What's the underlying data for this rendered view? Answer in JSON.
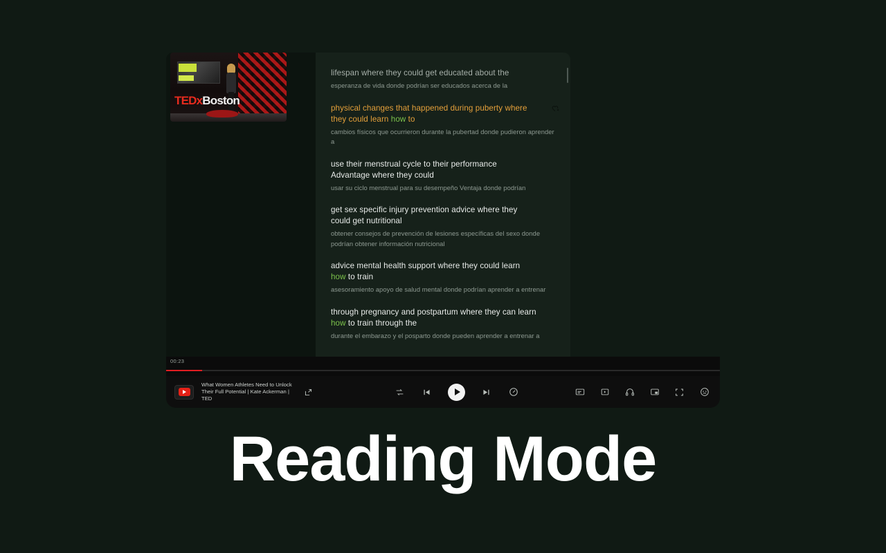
{
  "caption": "Reading Mode",
  "video": {
    "thumbnail_alt": "TEDxBoston stage with speaker",
    "logo_red": "TEDx",
    "logo_white": "Boston",
    "brand_color": "#e62b1e"
  },
  "transcript": {
    "scrollbar": "vertical-scrollbar",
    "cues": [
      {
        "state": "dim",
        "en_parts": [
          {
            "text": "lifespan where they could get educated about the",
            "kind": "plain"
          }
        ],
        "es": "esperanza de vida donde podrían ser educados acerca de la",
        "has_heart": false
      },
      {
        "state": "active",
        "en_parts": [
          {
            "text": "physical changes that happened during puberty where they could learn ",
            "kind": "plain"
          },
          {
            "text": "how",
            "kind": "keyword"
          },
          {
            "text": " to",
            "kind": "plain"
          }
        ],
        "es": "cambios físicos que ocurrieron durante la pubertad donde pudieron aprender a",
        "has_heart": true
      },
      {
        "state": "normal",
        "en_parts": [
          {
            "text": "use their menstrual cycle to their performance Advantage where they could",
            "kind": "plain"
          }
        ],
        "es": "usar su ciclo menstrual para su desempeño Ventaja donde podrían",
        "has_heart": false
      },
      {
        "state": "normal",
        "en_parts": [
          {
            "text": "get sex specific injury prevention advice where they could get nutritional",
            "kind": "plain"
          }
        ],
        "es": "obtener consejos de prevención de lesiones específicas del sexo donde podrían obtener información nutricional",
        "has_heart": false
      },
      {
        "state": "normal",
        "en_parts": [
          {
            "text": "advice mental health support where they could learn ",
            "kind": "plain"
          },
          {
            "text": "how",
            "kind": "keyword"
          },
          {
            "text": " to train",
            "kind": "plain"
          }
        ],
        "es": "asesoramiento apoyo de salud mental donde podrían aprender a entrenar",
        "has_heart": false
      },
      {
        "state": "normal",
        "en_parts": [
          {
            "text": "through pregnancy and postpartum where they can learn ",
            "kind": "plain"
          },
          {
            "text": "how",
            "kind": "keyword"
          },
          {
            "text": " to train through the",
            "kind": "plain"
          }
        ],
        "es": "durante el embarazo y el posparto donde pueden aprender a entrenar a",
        "has_heart": false
      }
    ]
  },
  "player": {
    "current_time": "00:23",
    "progress_percent": 6.5,
    "progress_color": "#e21d22",
    "source_icon": "youtube-icon",
    "video_title": "What Women Athletes Need to Unlock Their Full Potential | Kate Ackerman | TED",
    "left_controls": [
      {
        "name": "popout-window-icon",
        "label": "Pop out"
      }
    ],
    "center_controls": [
      {
        "name": "repeat-icon",
        "label": "Repeat"
      },
      {
        "name": "previous-track-icon",
        "label": "Previous"
      },
      {
        "name": "play-icon",
        "label": "Play"
      },
      {
        "name": "next-track-icon",
        "label": "Next"
      },
      {
        "name": "playback-speed-icon",
        "label": "Playback speed"
      }
    ],
    "right_controls": [
      {
        "name": "subtitles-icon",
        "label": "Subtitles"
      },
      {
        "name": "reading-mode-icon",
        "label": "Reading mode"
      },
      {
        "name": "headphones-icon",
        "label": "Audio mode"
      },
      {
        "name": "picture-in-picture-icon",
        "label": "Picture in picture"
      },
      {
        "name": "fullscreen-icon",
        "label": "Fullscreen"
      },
      {
        "name": "emoji-icon",
        "label": "Reactions"
      }
    ]
  },
  "colors": {
    "background": "#101a14",
    "panel": "#16211a",
    "active_cue": "#e5a03a",
    "keyword": "#7cc24b",
    "translation": "#8e9a92"
  }
}
